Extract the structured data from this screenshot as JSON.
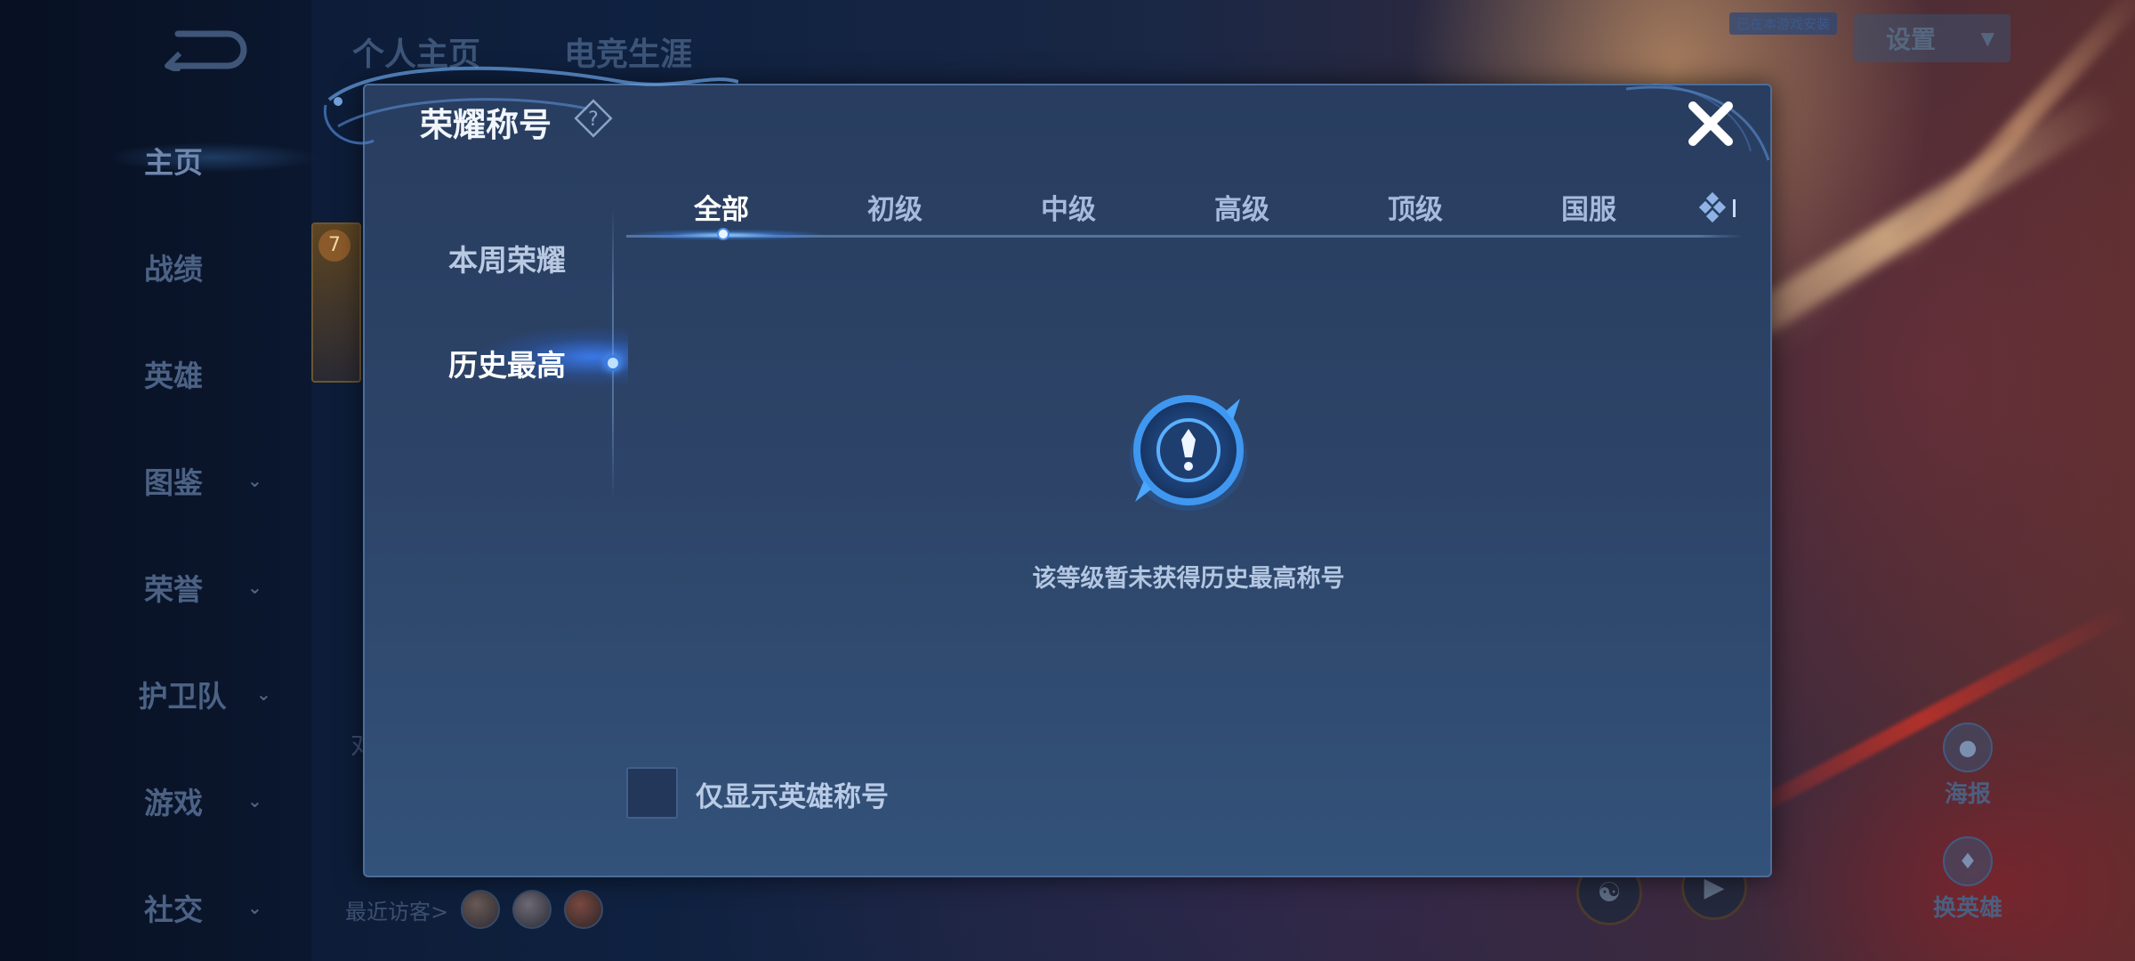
{
  "background": {
    "top_tabs": [
      "个人主页",
      "电竞生涯"
    ],
    "nav_items": [
      {
        "label": "主页",
        "has_chevron": false
      },
      {
        "label": "战绩",
        "has_chevron": false
      },
      {
        "label": "英雄",
        "has_chevron": false
      },
      {
        "label": "图鉴",
        "has_chevron": true
      },
      {
        "label": "荣誉",
        "has_chevron": true
      },
      {
        "label": "护卫队",
        "has_chevron": true
      },
      {
        "label": "游戏",
        "has_chevron": true
      },
      {
        "label": "社交",
        "has_chevron": true
      }
    ],
    "settings_label": "设置",
    "game_tag": "已在本游戏安装",
    "card_level": "7",
    "recent_visitors_label": "最近访客>",
    "poster_label": "海报",
    "change_hero_label": "换英雄",
    "partial_text": "对"
  },
  "modal": {
    "title": "荣耀称号",
    "side_tabs": [
      "本周荣耀",
      "历史最高"
    ],
    "active_side_tab": "历史最高",
    "level_tabs": [
      "全部",
      "初级",
      "中级",
      "高级",
      "顶级",
      "国服"
    ],
    "active_level_tab": "全部",
    "empty_message": "该等级暂未获得历史最高称号",
    "checkbox_label": "仅显示英雄称号",
    "checkbox_checked": false
  },
  "colors": {
    "accent": "#3a7ce0",
    "modal_bg": "#2d4468",
    "text_active": "#ffffff",
    "text_inactive": "#a5bbdd"
  }
}
